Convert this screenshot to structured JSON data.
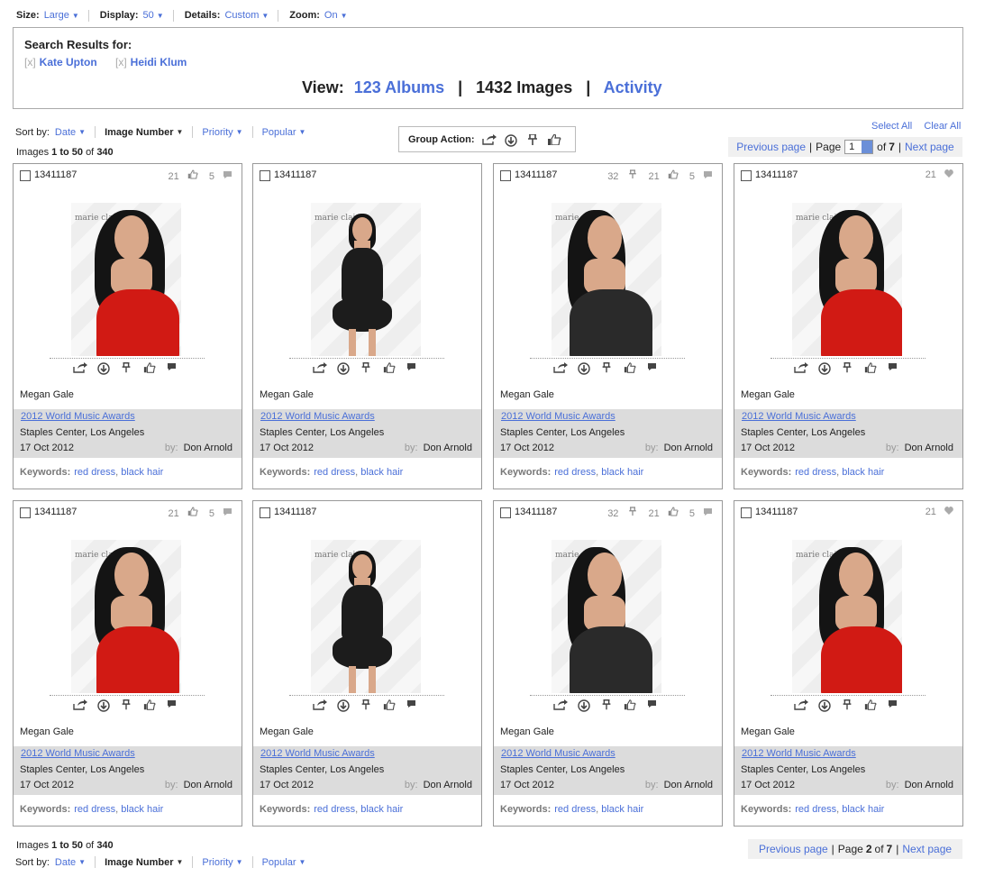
{
  "options": [
    {
      "label": "Size:",
      "value": "Large"
    },
    {
      "label": "Display:",
      "value": "50"
    },
    {
      "label": "Details:",
      "value": "Custom"
    },
    {
      "label": "Zoom:",
      "value": "On"
    }
  ],
  "search": {
    "title": "Search Results for:",
    "terms": [
      {
        "remove": "[x]",
        "name": "Kate Upton"
      },
      {
        "remove": "[x]",
        "name": "Heidi Klum"
      }
    ],
    "view_label": "View:",
    "albums": "123 Albums",
    "images": "1432 Images",
    "activity": "Activity",
    "sep": "|"
  },
  "sort": {
    "label": "Sort by:",
    "items": [
      "Date",
      "Image Number",
      "Priority",
      "Popular"
    ]
  },
  "count": {
    "prefix": "Images",
    "range": "1 to 50",
    "of": "of",
    "total": "340"
  },
  "group_action": {
    "label": "Group Action:"
  },
  "selection": {
    "select_all": "Select All",
    "clear_all": "Clear All"
  },
  "pager_top": {
    "prev": "Previous page",
    "page_label": "Page",
    "page_value": "1",
    "of": "of",
    "total": "7",
    "next": "Next page"
  },
  "pager_bottom": {
    "prev": "Previous page",
    "page_label": "Page",
    "page_value": "2",
    "of": "of",
    "total": "7",
    "next": "Next page"
  },
  "cards": [
    {
      "id": "13411187",
      "stats": [
        "21",
        "5"
      ],
      "person": "Megan Gale",
      "event": "2012 World Music Awards",
      "place": "Staples Center,  Los Angeles",
      "date": "17 Oct 2012",
      "by": "by:",
      "photographer": "Don Arnold",
      "kw_label": "Keywords:",
      "keywords": [
        "red dress",
        "black hair"
      ],
      "photo": "red"
    },
    {
      "id": "13411187",
      "stats": [],
      "person": "Megan Gale",
      "event": "2012 World Music Awards",
      "place": "Staples Center,  Los Angeles",
      "date": "17 Oct 2012",
      "by": "by:",
      "photographer": "Don Arnold",
      "kw_label": "Keywords:",
      "keywords": [
        "red dress",
        "black hair"
      ],
      "photo": "black"
    },
    {
      "id": "13411187",
      "stats": [
        "32",
        "21",
        "5"
      ],
      "person": "Megan Gale",
      "event": "2012 World Music Awards",
      "place": "Staples Center,  Los Angeles",
      "date": "17 Oct 2012",
      "by": "by:",
      "photographer": "Don Arnold",
      "kw_label": "Keywords:",
      "keywords": [
        "red dress",
        "black hair"
      ],
      "photo": "close"
    },
    {
      "id": "13411187",
      "stats": [
        "21"
      ],
      "person": "Megan Gale",
      "event": "2012 World Music Awards",
      "place": "Staples Center,  Los Angeles",
      "date": "17 Oct 2012",
      "by": "by:",
      "photographer": "Don Arnold",
      "kw_label": "Keywords:",
      "keywords": [
        "red dress",
        "black hair"
      ],
      "photo": "red2"
    },
    {
      "id": "13411187",
      "stats": [
        "21",
        "5"
      ],
      "person": "Megan Gale",
      "event": "2012 World Music Awards",
      "place": "Staples Center,  Los Angeles",
      "date": "17 Oct 2012",
      "by": "by:",
      "photographer": "Don Arnold",
      "kw_label": "Keywords:",
      "keywords": [
        "red dress",
        "black hair"
      ],
      "photo": "red"
    },
    {
      "id": "13411187",
      "stats": [],
      "person": "Megan Gale",
      "event": "2012 World Music Awards",
      "place": "Staples Center,  Los Angeles",
      "date": "17 Oct 2012",
      "by": "by:",
      "photographer": "Don Arnold",
      "kw_label": "Keywords:",
      "keywords": [
        "red dress",
        "black hair"
      ],
      "photo": "black"
    },
    {
      "id": "13411187",
      "stats": [
        "32",
        "21",
        "5"
      ],
      "person": "Megan Gale",
      "event": "2012 World Music Awards",
      "place": "Staples Center,  Los Angeles",
      "date": "17 Oct 2012",
      "by": "by:",
      "photographer": "Don Arnold",
      "kw_label": "Keywords:",
      "keywords": [
        "red dress",
        "black hair"
      ],
      "photo": "close"
    },
    {
      "id": "13411187",
      "stats": [
        "21"
      ],
      "person": "Megan Gale",
      "event": "2012 World Music Awards",
      "place": "Staples Center,  Los Angeles",
      "date": "17 Oct 2012",
      "by": "by:",
      "photographer": "Don Arnold",
      "kw_label": "Keywords:",
      "keywords": [
        "red dress",
        "black hair"
      ],
      "photo": "red2"
    }
  ],
  "colors": {
    "link": "#4a6fd8",
    "meta_bg": "#dcdcdc",
    "dress_red": "#d11a14",
    "dress_black": "#1c1c1c"
  }
}
